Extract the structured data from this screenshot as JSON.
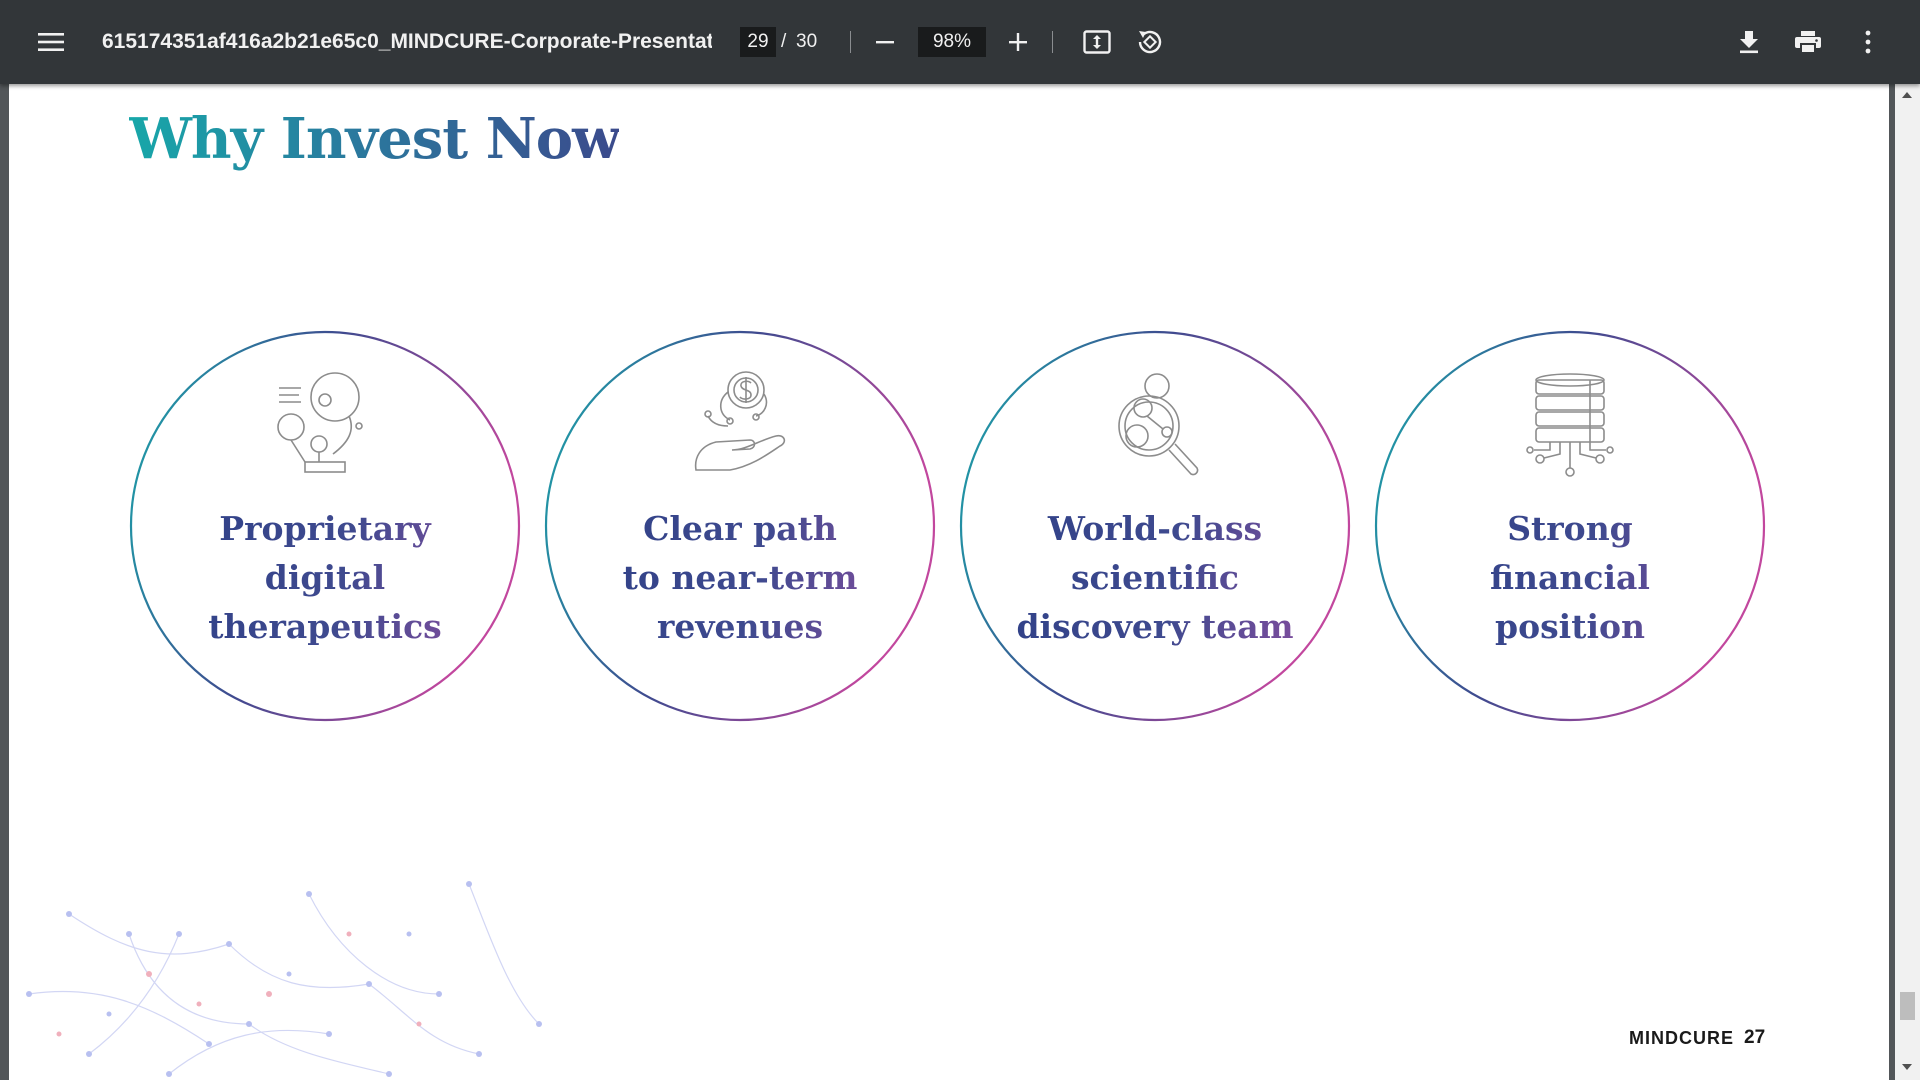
{
  "toolbar": {
    "title": "615174351af416a2b21e65c0_MINDCURE-Corporate-Presentat...",
    "current_page": "29",
    "page_separator": "/",
    "total_pages": "30",
    "zoom": "98%",
    "icons": {
      "menu": "menu-icon",
      "zoom_out": "minus-icon",
      "zoom_in": "plus-icon",
      "fit": "fit-page-icon",
      "rotate": "rotate-icon",
      "download": "download-icon",
      "print": "print-icon",
      "more": "more-vert-icon"
    },
    "colors": {
      "background": "#323639",
      "text": "#f1f1f1"
    }
  },
  "slide": {
    "title": "Why Invest Now",
    "cards": [
      {
        "icon": "digital-therapeutics-icon",
        "lines": [
          "Proprietary",
          "digital",
          "therapeutics"
        ]
      },
      {
        "icon": "hand-dollar-icon",
        "lines": [
          "Clear path",
          "to near-term",
          "revenues"
        ]
      },
      {
        "icon": "magnifier-molecule-icon",
        "lines": [
          "World-class",
          "scientific",
          "discovery team"
        ]
      },
      {
        "icon": "database-network-icon",
        "lines": [
          "Strong",
          "financial",
          "position"
        ]
      }
    ],
    "brand": "MINDCURE",
    "page_number": "27",
    "colors": {
      "teal": "#17a7a9",
      "navy": "#2d3f86",
      "magenta": "#c2479e"
    }
  }
}
